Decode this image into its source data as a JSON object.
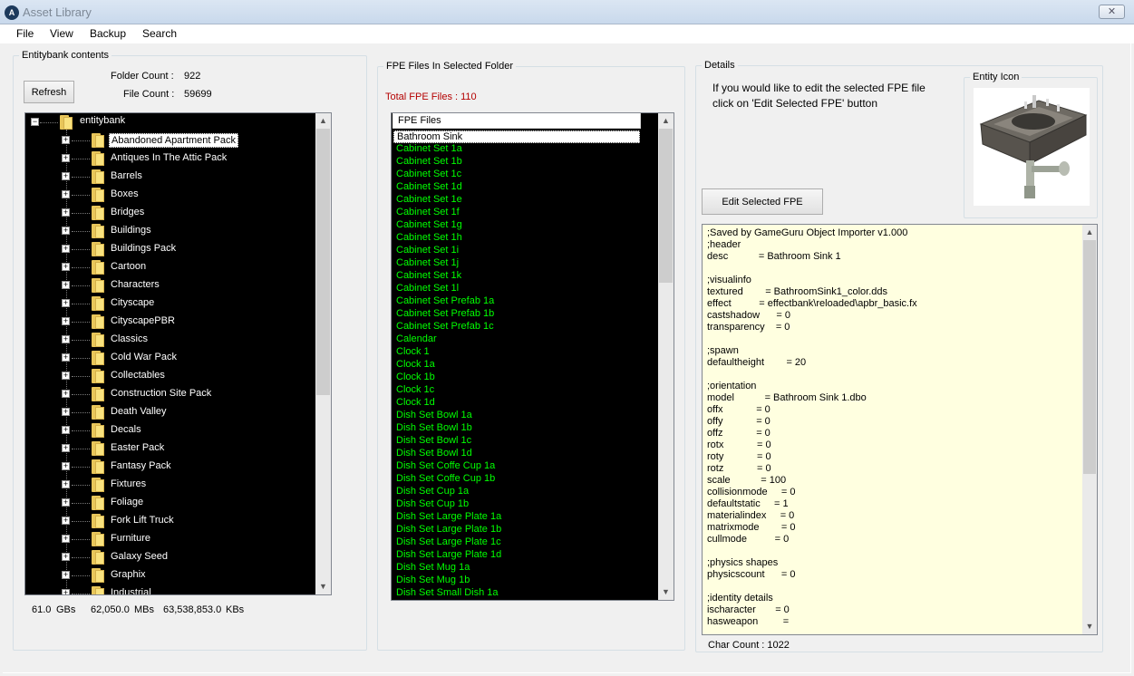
{
  "window": {
    "title": "Asset Library",
    "close_glyph": "✕",
    "app_icon": "asset-library-logo"
  },
  "menu": {
    "items": [
      "File",
      "View",
      "Backup",
      "Search"
    ]
  },
  "entitybank": {
    "group_label": "Entitybank contents",
    "refresh_label": "Refresh",
    "folder_count_label": "Folder Count :",
    "folder_count": "922",
    "file_count_label": "File Count :",
    "file_count": "59699",
    "root_label": "entitybank",
    "selected_folder": "Abandoned Apartment Pack",
    "folders": [
      "Abandoned Apartment Pack",
      "Antiques In The Attic Pack",
      "Barrels",
      "Boxes",
      "Bridges",
      "Buildings",
      "Buildings Pack",
      "Cartoon",
      "Characters",
      "Cityscape",
      "CityscapePBR",
      "Classics",
      "Cold War Pack",
      "Collectables",
      "Construction Site Pack",
      "Death Valley",
      "Decals",
      "Easter Pack",
      "Fantasy Pack",
      "Fixtures",
      "Foliage",
      "Fork Lift Truck",
      "Furniture",
      "Galaxy Seed",
      "Graphix",
      "Industrial"
    ],
    "size_gb": "61.0",
    "size_gb_unit": "GBs",
    "size_mb": "62,050.0",
    "size_mb_unit": "MBs",
    "size_kb": "63,538,853.0",
    "size_kb_unit": "KBs"
  },
  "fpe": {
    "group_label": "FPE Files In Selected Folder",
    "total_label": "Total FPE Files : 110",
    "total_color": "#b40000",
    "column_header": "FPE Files",
    "selected_file": "Bathroom Sink",
    "item_color": "#00ff00",
    "files": [
      "Bathroom Sink",
      "Cabinet Set 1a",
      "Cabinet Set 1b",
      "Cabinet Set 1c",
      "Cabinet Set 1d",
      "Cabinet Set 1e",
      "Cabinet Set 1f",
      "Cabinet Set 1g",
      "Cabinet Set 1h",
      "Cabinet Set 1i",
      "Cabinet Set 1j",
      "Cabinet Set 1k",
      "Cabinet Set 1l",
      "Cabinet Set Prefab 1a",
      "Cabinet Set Prefab 1b",
      "Cabinet Set Prefab 1c",
      "Calendar",
      "Clock 1",
      "Clock 1a",
      "Clock 1b",
      "Clock 1c",
      "Clock 1d",
      "Dish Set Bowl 1a",
      "Dish Set Bowl 1b",
      "Dish Set Bowl 1c",
      "Dish Set Bowl 1d",
      "Dish Set Coffe Cup 1a",
      "Dish Set Coffe Cup 1b",
      "Dish Set Cup 1a",
      "Dish Set Cup 1b",
      "Dish Set Large Plate 1a",
      "Dish Set Large Plate 1b",
      "Dish Set Large Plate 1c",
      "Dish Set Large Plate 1d",
      "Dish Set Mug 1a",
      "Dish Set Mug 1b",
      "Dish Set Small Dish 1a"
    ]
  },
  "details": {
    "group_label": "Details",
    "instructions_line1": "If you would like to edit the selected FPE file",
    "instructions_line2": "click on 'Edit Selected FPE' button",
    "entity_icon_label": "Entity Icon",
    "entity_icon_subject": "bathroom-sink-thumbnail",
    "edit_button_label": "Edit Selected FPE",
    "char_count_label": "Char Count : 1022",
    "fpe_lines": [
      ";Saved by GameGuru Object Importer v1.000",
      ";header",
      "desc           = Bathroom Sink 1",
      "",
      ";visualinfo",
      "textured        = BathroomSink1_color.dds",
      "effect          = effectbank\\reloaded\\apbr_basic.fx",
      "castshadow      = 0",
      "transparency    = 0",
      "",
      ";spawn",
      "defaultheight        = 20",
      "",
      ";orientation",
      "model           = Bathroom Sink 1.dbo",
      "offx            = 0",
      "offy            = 0",
      "offz            = 0",
      "rotx            = 0",
      "roty            = 0",
      "rotz            = 0",
      "scale           = 100",
      "collisionmode     = 0",
      "defaultstatic     = 1",
      "materialindex     = 0",
      "matrixmode        = 0",
      "cullmode          = 0",
      "",
      ";physics shapes",
      "physicscount      = 0",
      "",
      ";identity details",
      "ischaracter       = 0",
      "hasweapon         ="
    ]
  }
}
